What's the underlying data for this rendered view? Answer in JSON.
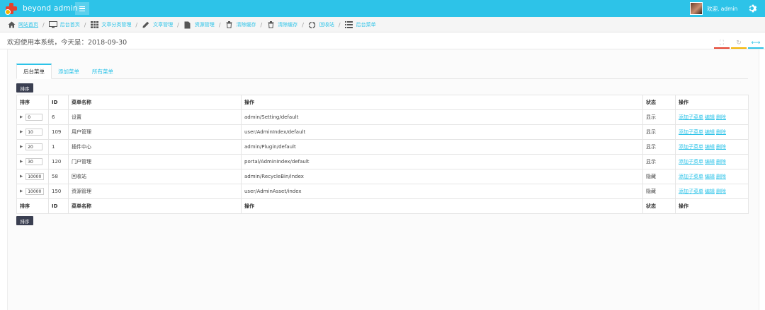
{
  "header": {
    "brand": "beyond admin",
    "user_greeting": "欢迎, admin",
    "colors": {
      "topbar": "#2dc3e8",
      "accent": "#2dc3e8",
      "dark_button": "#3a3f51"
    }
  },
  "breadcrumb": [
    {
      "icon": "home-icon",
      "label": "网站首页"
    },
    {
      "icon": "desktop-icon",
      "label": "后台首页"
    },
    {
      "icon": "grid-icon",
      "label": "文章分类管理"
    },
    {
      "icon": "pencil-icon",
      "label": "文章管理"
    },
    {
      "icon": "file-icon",
      "label": "资源管理"
    },
    {
      "icon": "trash-icon",
      "label": "清除缓存"
    },
    {
      "icon": "trash-icon",
      "label": "清除缓存"
    },
    {
      "icon": "recycle-icon",
      "label": "回收站"
    },
    {
      "icon": "list-icon",
      "label": "后台菜单"
    }
  ],
  "page": {
    "welcome": "欢迎使用本系统，今天是：2018-09-30"
  },
  "tabs": [
    "后台菜单",
    "添加菜单",
    "所有菜单"
  ],
  "toolbar": {
    "sort_label": "排序"
  },
  "table": {
    "headers": [
      "排序",
      "ID",
      "菜单名称",
      "操作",
      "状态",
      "操作"
    ],
    "rows": [
      {
        "sort": "0",
        "id": "6",
        "name": "设置",
        "action": "admin/Setting/default",
        "status": "显示",
        "ops": [
          "添加子菜单",
          "编辑",
          "删除"
        ]
      },
      {
        "sort": "10",
        "id": "109",
        "name": "用户管理",
        "action": "user/AdminIndex/default",
        "status": "显示",
        "ops": [
          "添加子菜单",
          "编辑",
          "删除"
        ]
      },
      {
        "sort": "20",
        "id": "1",
        "name": "插件中心",
        "action": "admin/Plugin/default",
        "status": "显示",
        "ops": [
          "添加子菜单",
          "编辑",
          "删除"
        ]
      },
      {
        "sort": "30",
        "id": "120",
        "name": "门户管理",
        "action": "portal/AdminIndex/default",
        "status": "显示",
        "ops": [
          "添加子菜单",
          "编辑",
          "删除"
        ]
      },
      {
        "sort": "10000",
        "id": "58",
        "name": "回收站",
        "action": "admin/RecycleBin/index",
        "status": "隐藏",
        "ops": [
          "添加子菜单",
          "编辑",
          "删除"
        ]
      },
      {
        "sort": "10000",
        "id": "150",
        "name": "资源管理",
        "action": "user/AdminAsset/index",
        "status": "隐藏",
        "ops": [
          "添加子菜单",
          "编辑",
          "删除"
        ]
      }
    ]
  }
}
